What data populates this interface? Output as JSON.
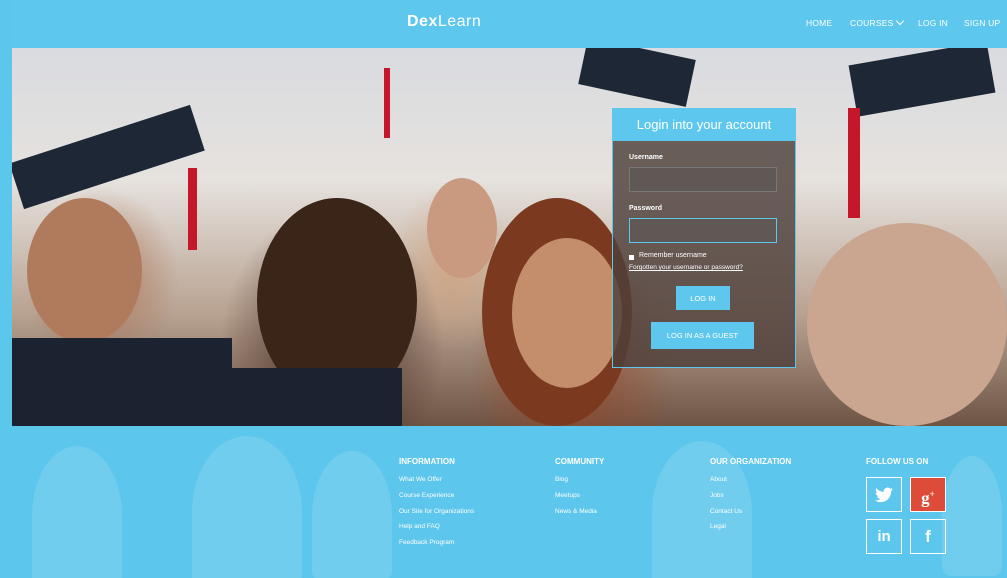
{
  "header": {
    "logo_bold": "Dex",
    "logo_light": "Learn",
    "nav": {
      "home": "HOME",
      "courses": "COURSES",
      "login": "LOG IN",
      "signup": "SIGN UP"
    }
  },
  "login": {
    "title": "Login into your account",
    "username_label": "Username",
    "username_value": "",
    "password_label": "Password",
    "password_value": "",
    "remember_label": "Remember username",
    "forgot_link": "Forgotten your username or password?",
    "login_button": "LOG IN",
    "guest_button": "LOG IN AS A GUEST"
  },
  "footer": {
    "information": {
      "title": "INFORMATION",
      "links": [
        "What We Offer",
        "Course Experience",
        "Our Site for Organizations",
        "Help and FAQ",
        "Feedback Program"
      ]
    },
    "community": {
      "title": "COMMUNITY",
      "links": [
        "Blog",
        "Meetups",
        "News & Media"
      ]
    },
    "organization": {
      "title": "OUR ORGANIZATION",
      "links": [
        "About",
        "Jobs",
        "Contact Us",
        "Legal"
      ]
    },
    "follow": {
      "title": "FOLLOW US ON",
      "icons": {
        "twitter": "twitter-icon",
        "google_plus": "google-plus-icon",
        "linkedin": "linkedin-icon",
        "facebook": "facebook-icon"
      }
    }
  },
  "colors": {
    "accent": "#5ec7ee",
    "google_plus": "#dd4b39",
    "login_panel": "#4e403a"
  }
}
